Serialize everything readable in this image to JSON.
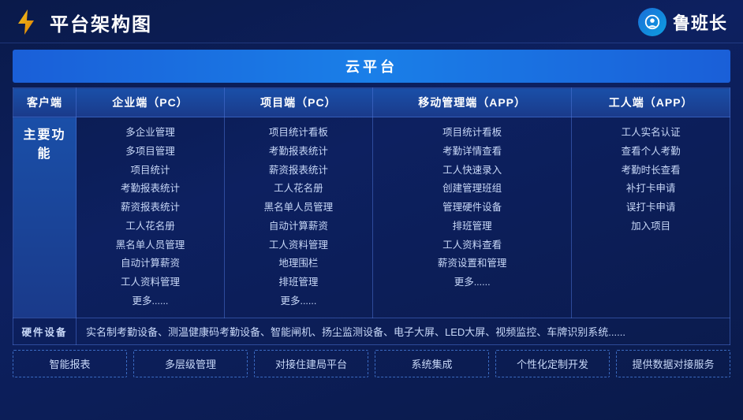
{
  "header": {
    "title": "平台架构图",
    "brand_name": "鲁班长"
  },
  "cloud_bar": "云平台",
  "columns": [
    {
      "label": "客户端"
    },
    {
      "label": "企业端（PC）"
    },
    {
      "label": "项目端（PC）"
    },
    {
      "label": "移动管理端（APP）"
    },
    {
      "label": "工人端（APP）"
    }
  ],
  "rows": [
    {
      "header": "主要功能",
      "cells": [
        {
          "items": [
            "多企业管理",
            "多项目管理",
            "项目统计",
            "考勤报表统计",
            "薪资报表统计",
            "工人花名册",
            "黑名单人员管理",
            "自动计算薪资",
            "工人资料管理",
            "更多......"
          ]
        },
        {
          "items": [
            "项目统计看板",
            "考勤报表统计",
            "薪资报表统计",
            "工人花名册",
            "黑名单人员管理",
            "自动计算薪资",
            "工人资料管理",
            "地理围栏",
            "排班管理",
            "更多......"
          ]
        },
        {
          "items": [
            "项目统计看板",
            "考勤详情查看",
            "工人快速录入",
            "创建管理班组",
            "管理硬件设备",
            "排班管理",
            "工人资料查看",
            "薪资设置和管理",
            "更多......"
          ]
        },
        {
          "items": [
            "工人实名认证",
            "查看个人考勤",
            "考勤时长查看",
            "补打卡申请",
            "误打卡申请",
            "加入项目"
          ]
        }
      ]
    }
  ],
  "hardware": {
    "header": "硬件设备",
    "content": "实名制考勤设备、测温健康码考勤设备、智能闸机、扬尘监测设备、电子大屏、LED大屏、视频监控、车牌识别系统......"
  },
  "bottom_items": [
    "智能报表",
    "多层级管理",
    "对接住建局平台",
    "系统集成",
    "个性化定制开发",
    "提供数据对接服务"
  ]
}
